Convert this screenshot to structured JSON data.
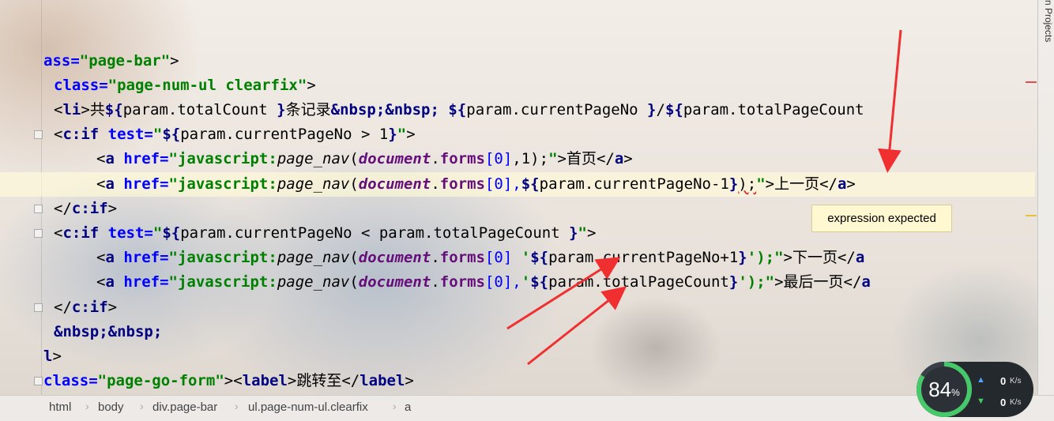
{
  "editor": {
    "lines": {
      "l1": {
        "s1": "ass=",
        "s2": "\"page-bar\"",
        "s3": ">"
      },
      "l2": {
        "s1": "class=",
        "s2": "\"page-num-ul clearfix\"",
        "s3": ">"
      },
      "l3": {
        "s1": "<",
        "s2": "li",
        "s3": ">共",
        "s4": "${",
        "s5": "param.totalCount ",
        "s6": "}",
        "s7": "条记录",
        "s8": "&nbsp;&nbsp;",
        "s9": " ",
        "s10": "${",
        "s11": "param.currentPageNo ",
        "s12": "}",
        "s13": "/",
        "s14": "${",
        "s15": "param.totalPageCount"
      },
      "l4": {
        "s1": "<",
        "s2": "c:if",
        "s3": " test=",
        "s4": "\"",
        "s5": "${",
        "s6": "param.currentPageNo > 1",
        "s7": "}",
        "s8": "\"",
        "s9": ">"
      },
      "l5": {
        "s1": "<",
        "s2": "a",
        "s3": " href=",
        "s4": "\"javascript:",
        "s5": "page_nav",
        "s6": "(",
        "s7": "document",
        "s8": ".",
        "s9": "forms",
        "s10": "[0]",
        "s11": ",1);",
        "s12": "\"",
        "s13": ">首页</",
        "s14": "a",
        "s15": ">"
      },
      "l6": {
        "s1": "<",
        "s2": "a",
        "s3": " href=",
        "s4": "\"javascript:",
        "s5": "page_nav",
        "s6": "(",
        "s7": "document",
        "s8": ".",
        "s9": "forms",
        "s10": "[0],",
        "s11": "${",
        "s12": "param.currentPageNo-1",
        "s13": "}",
        "s14": ");",
        "s15": "\"",
        "s16": ">上一页</",
        "s17": "a",
        "s18": ">"
      },
      "l7": {
        "s1": "</",
        "s2": "c:if",
        "s3": ">"
      },
      "l8": {
        "s1": "<",
        "s2": "c:if",
        "s3": " test=",
        "s4": "\"",
        "s5": "${",
        "s6": "param.currentPageNo < param.totalPageCount ",
        "s7": "}",
        "s8": "\"",
        "s9": ">"
      },
      "l9": {
        "s1": "<",
        "s2": "a",
        "s3": " href=",
        "s4": "\"javascript:",
        "s5": "page_nav",
        "s6": "(",
        "s7": "document",
        "s8": ".",
        "s9": "forms",
        "s10": "[0]",
        "s11": " '",
        "s12": "${",
        "s13": "param.currentPageNo+1",
        "s14": "}",
        "s15": "');",
        "s16": "\"",
        "s17": ">下一页</",
        "s18": "a"
      },
      "l10": {
        "s1": "<",
        "s2": "a",
        "s3": " href=",
        "s4": "\"javascript:",
        "s5": "page_nav",
        "s6": "(",
        "s7": "document",
        "s8": ".",
        "s9": "forms",
        "s10": "[0],",
        "s11": "'",
        "s12": "${",
        "s13": "param.totalPageCount",
        "s14": "}",
        "s15": "');",
        "s16": "\"",
        "s17": ">最后一页</",
        "s18": "a"
      },
      "l11": {
        "s1": "</",
        "s2": "c:if",
        "s3": ">"
      },
      "l12": {
        "s1": "&nbsp;&nbsp;"
      },
      "l13": {
        "s1": "l",
        "s2": ">"
      },
      "l14": {
        "s1": "class=",
        "s2": "\"page-go-form\"",
        "s3": "><",
        "s4": "label",
        "s5": ">跳转至</",
        "s6": "label",
        "s7": ">"
      }
    }
  },
  "tooltip": {
    "text": "expression expected"
  },
  "right_panel": {
    "tab_label": "n Projects"
  },
  "breadcrumb": [
    "html",
    "body",
    "div.page-bar",
    "ul.page-num-ul.clearfix",
    "a"
  ],
  "network": {
    "percent": "84",
    "percent_sign": "%",
    "upload": "0",
    "download": "0",
    "unit": "K/s"
  },
  "colors": {
    "arrow": "#f03030",
    "tooltip_bg": "#fff8d0",
    "gauge": "#47c96b"
  }
}
